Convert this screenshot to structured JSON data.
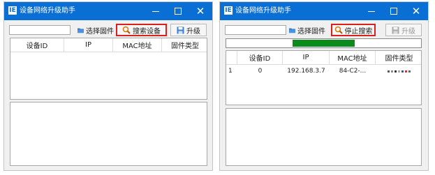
{
  "windows": [
    {
      "title": "设备网络升级助手",
      "app_icon": "IE",
      "search_input": {
        "value": "",
        "placeholder": ""
      },
      "buttons": {
        "select_firmware": {
          "label": "选择固件",
          "icon": "folder-icon"
        },
        "search": {
          "label": "搜索设备",
          "icon": "magnifier-icon",
          "highlighted": true
        },
        "upgrade": {
          "label": "升级",
          "icon": "save-icon",
          "enabled": true
        }
      },
      "table": {
        "columns": [
          "设备ID",
          "IP",
          "MAC地址",
          "固件类型"
        ],
        "rows": []
      }
    },
    {
      "title": "设备网络升级助手",
      "app_icon": "IE",
      "search_input": {
        "value": "",
        "placeholder": ""
      },
      "buttons": {
        "select_firmware": {
          "label": "选择固件",
          "icon": "folder-icon"
        },
        "stop_search": {
          "label": "停止搜索",
          "icon": "magnifier-icon",
          "highlighted": true
        },
        "upgrade": {
          "label": "升级",
          "icon": "save-icon",
          "enabled": false
        }
      },
      "progress": {
        "fill_start": 0.34,
        "fill_end": 0.66,
        "color": "#0b8a1d"
      },
      "table": {
        "columns": [
          "设备ID",
          "IP",
          "MAC地址",
          "固件类型"
        ],
        "rows": [
          {
            "row_number": "1",
            "device_id": "0",
            "ip": "192.168.3.7",
            "mac": "84-C2-...",
            "firmware": ""
          }
        ]
      }
    }
  ],
  "colors": {
    "title_bar": "#0a6fd4",
    "highlight_border": "#d9201e",
    "progress_fill": "#0b8a1d"
  }
}
